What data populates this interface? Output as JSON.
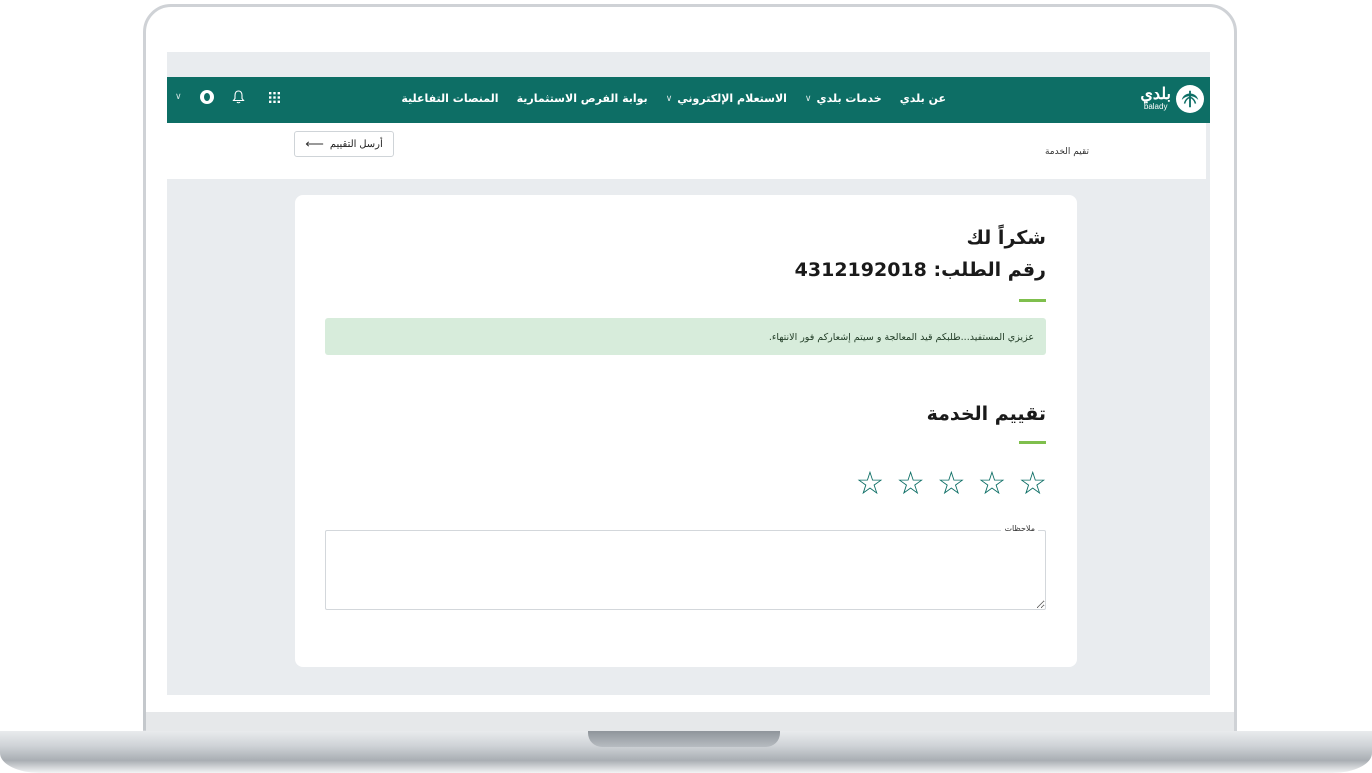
{
  "brand": {
    "name_ar": "بلدي",
    "name_en": "balady"
  },
  "nav": {
    "items": [
      {
        "label": "عن بلدي",
        "has_dropdown": false
      },
      {
        "label": "خدمات بلدي",
        "has_dropdown": true
      },
      {
        "label": "الاستعلام الإلكتروني",
        "has_dropdown": true
      },
      {
        "label": "بوابة الفرص الاستثمارية",
        "has_dropdown": false
      },
      {
        "label": "المنصات التفاعلية",
        "has_dropdown": false
      }
    ],
    "tools": [
      "grid-icon",
      "bell-icon",
      "globe-icon",
      "chevron-down-icon"
    ]
  },
  "subheader": {
    "breadcrumb": "تقيم الخدمة",
    "send_button": "أرسل التقييم"
  },
  "card": {
    "thanks": "شكراً لك",
    "request_label": "رقم الطلب: 4312192018",
    "alert": "عزيزي المستفيد...طلبكم قيد المعالجة و سيتم إشعاركم فور الانتهاء.",
    "rating_title": "تقييم الخدمة",
    "stars_total": 5,
    "stars_selected": 0,
    "notes_label": "ملاحظات",
    "notes_value": ""
  },
  "colors": {
    "primary": "#0d6e65",
    "accent": "#7fbf4d",
    "alert_bg": "#d7ecdb"
  }
}
